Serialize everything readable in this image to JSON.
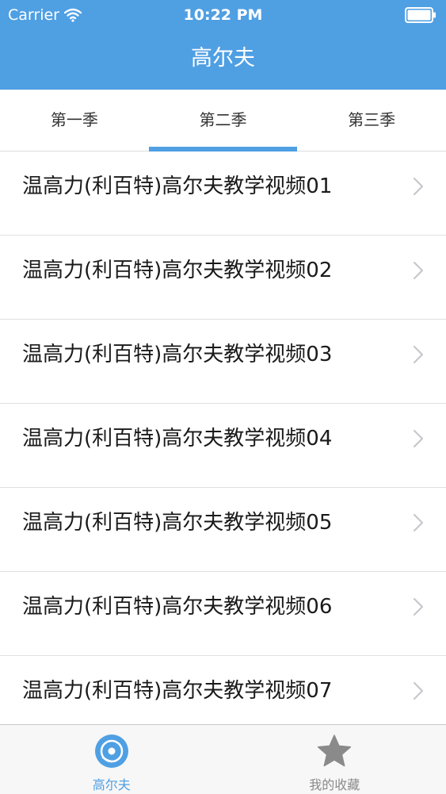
{
  "status_bar": {
    "carrier": "Carrier",
    "time": "10:22 PM"
  },
  "nav": {
    "title": "高尔夫"
  },
  "tabs": [
    {
      "label": "第一季",
      "active": false
    },
    {
      "label": "第二季",
      "active": true
    },
    {
      "label": "第三季",
      "active": false
    }
  ],
  "list": {
    "items": [
      {
        "label": "温高力(利百特)高尔夫教学视频01"
      },
      {
        "label": "温高力(利百特)高尔夫教学视频02"
      },
      {
        "label": "温高力(利百特)高尔夫教学视频03"
      },
      {
        "label": "温高力(利百特)高尔夫教学视频04"
      },
      {
        "label": "温高力(利百特)高尔夫教学视频05"
      },
      {
        "label": "温高力(利百特)高尔夫教学视频06"
      },
      {
        "label": "温高力(利百特)高尔夫教学视频07"
      }
    ]
  },
  "tabbar": {
    "items": [
      {
        "label": "高尔夫",
        "icon": "golf-disc-icon",
        "active": true
      },
      {
        "label": "我的收藏",
        "icon": "star-icon",
        "active": false
      }
    ]
  },
  "colors": {
    "accent": "#4f9fe3",
    "inactive": "#8a8a8a",
    "text": "#1a1a1a"
  }
}
